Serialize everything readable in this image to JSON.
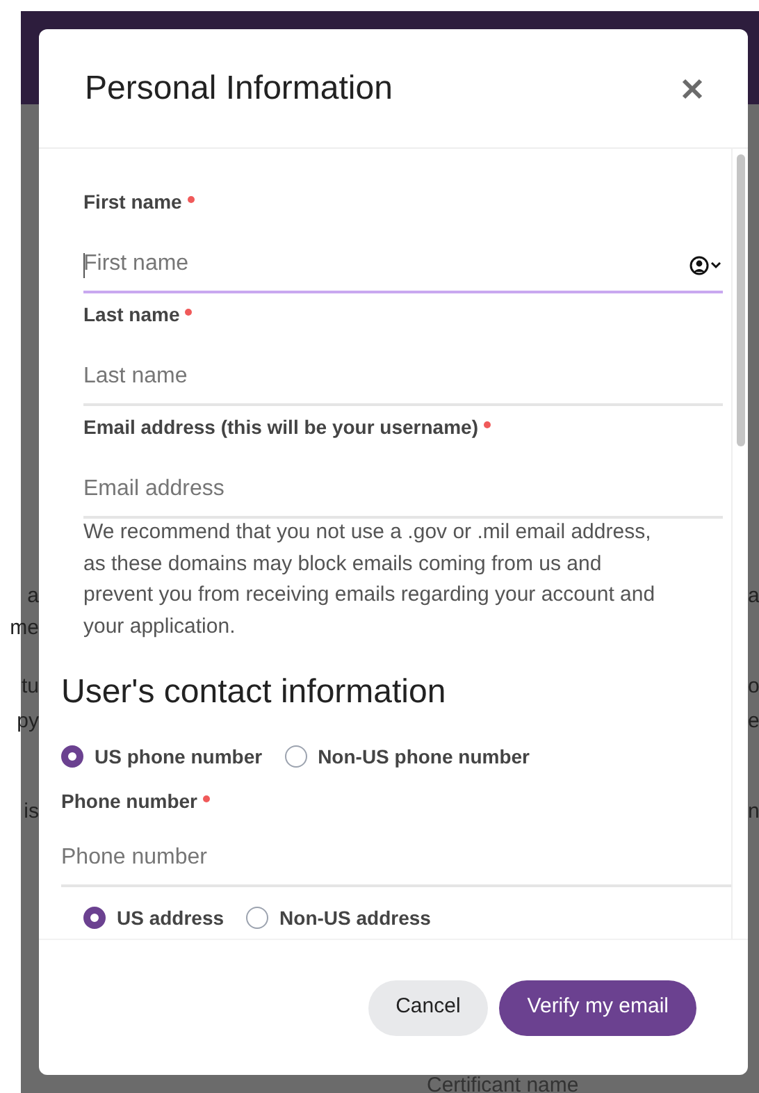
{
  "page": {
    "fragments_left": [
      "a",
      "me",
      "tu",
      "py",
      "is"
    ],
    "fragments_right": [
      "a",
      "o",
      "e",
      "n"
    ],
    "background_label": "Certificant name"
  },
  "dialog": {
    "title": "Personal Information",
    "fields": [
      {
        "label": "First name",
        "required": true,
        "placeholder": "First name",
        "focused": true,
        "autofill": true
      },
      {
        "label": "Last name",
        "required": true,
        "placeholder": "Last name",
        "focused": false,
        "autofill": false
      },
      {
        "label": "Email address (this will be your username)",
        "required": true,
        "placeholder": "Email address",
        "focused": false,
        "autofill": false
      }
    ],
    "note": "We recommend that you not use a .gov or .mil email address, as these domains may block emails coming from us and prevent you from receiving emails regarding your account and your application.",
    "contact": {
      "heading": "User's contact information",
      "phone_type": [
        {
          "label": "US phone number",
          "selected": true
        },
        {
          "label": "Non-US phone number",
          "selected": false
        }
      ],
      "phone_field": {
        "label": "Phone number",
        "required": true,
        "placeholder": "Phone number"
      },
      "address_type": [
        {
          "label": "US address",
          "selected": true
        },
        {
          "label": "Non-US address",
          "selected": false
        }
      ]
    },
    "buttons": [
      {
        "label": "Cancel",
        "kind": "secondary"
      },
      {
        "label": "Verify my email",
        "kind": "primary"
      }
    ]
  }
}
